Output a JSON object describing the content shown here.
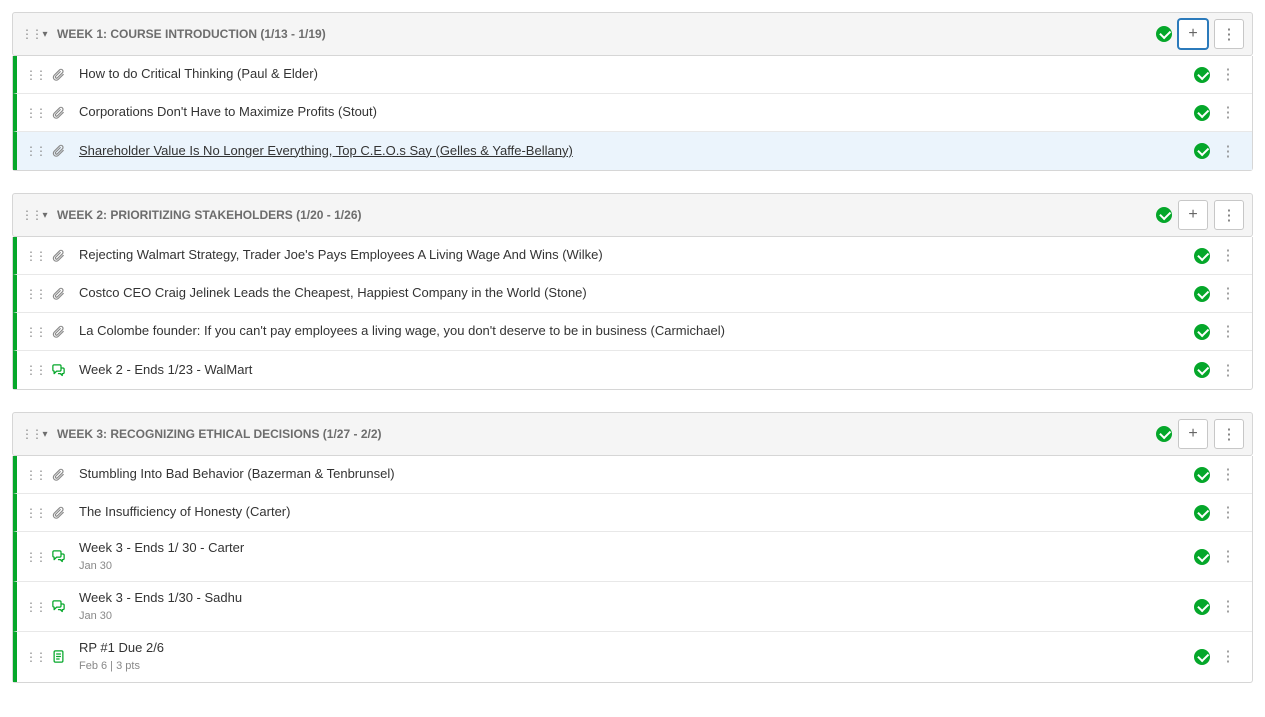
{
  "modules": [
    {
      "title": "WEEK 1: COURSE INTRODUCTION (1/13 - 1/19)",
      "addActive": true,
      "items": [
        {
          "type": "attachment",
          "title": "How to do Critical Thinking (Paul & Elder)",
          "selected": false,
          "link": false,
          "sub": null
        },
        {
          "type": "attachment",
          "title": "Corporations Don't Have to Maximize Profits (Stout)",
          "selected": false,
          "link": false,
          "sub": null
        },
        {
          "type": "attachment",
          "title": "Shareholder Value Is No Longer Everything, Top C.E.O.s Say (Gelles & Yaffe-Bellany)",
          "selected": true,
          "link": true,
          "sub": null
        }
      ]
    },
    {
      "title": "WEEK 2: PRIORITIZING STAKEHOLDERS (1/20 - 1/26)",
      "addActive": false,
      "items": [
        {
          "type": "attachment",
          "title": "Rejecting Walmart Strategy, Trader Joe's Pays Employees A Living Wage And Wins (Wilke)",
          "selected": false,
          "link": false,
          "sub": null
        },
        {
          "type": "attachment",
          "title": "Costco CEO Craig Jelinek Leads the Cheapest, Happiest Company in the World (Stone)",
          "selected": false,
          "link": false,
          "sub": null
        },
        {
          "type": "attachment",
          "title": "La Colombe founder: If you can't pay employees a living wage, you don't deserve to be in business (Carmichael)",
          "selected": false,
          "link": false,
          "sub": null
        },
        {
          "type": "discussion",
          "title": "Week 2 - Ends 1/23 - WalMart",
          "selected": false,
          "link": false,
          "sub": null
        }
      ]
    },
    {
      "title": "WEEK 3: RECOGNIZING ETHICAL DECISIONS (1/27 - 2/2)",
      "addActive": false,
      "items": [
        {
          "type": "attachment",
          "title": "Stumbling Into Bad Behavior (Bazerman & Tenbrunsel)",
          "selected": false,
          "link": false,
          "sub": null
        },
        {
          "type": "attachment",
          "title": "The Insufficiency of Honesty (Carter)",
          "selected": false,
          "link": false,
          "sub": null
        },
        {
          "type": "discussion",
          "title": "Week 3 - Ends 1/ 30 - Carter",
          "selected": false,
          "link": false,
          "sub": "Jan 30"
        },
        {
          "type": "discussion",
          "title": "Week 3 - Ends 1/30 - Sadhu",
          "selected": false,
          "link": false,
          "sub": "Jan 30"
        },
        {
          "type": "assignment",
          "title": "RP #1 Due 2/6",
          "selected": false,
          "link": false,
          "sub": "Feb 6  |  3 pts"
        }
      ]
    }
  ]
}
